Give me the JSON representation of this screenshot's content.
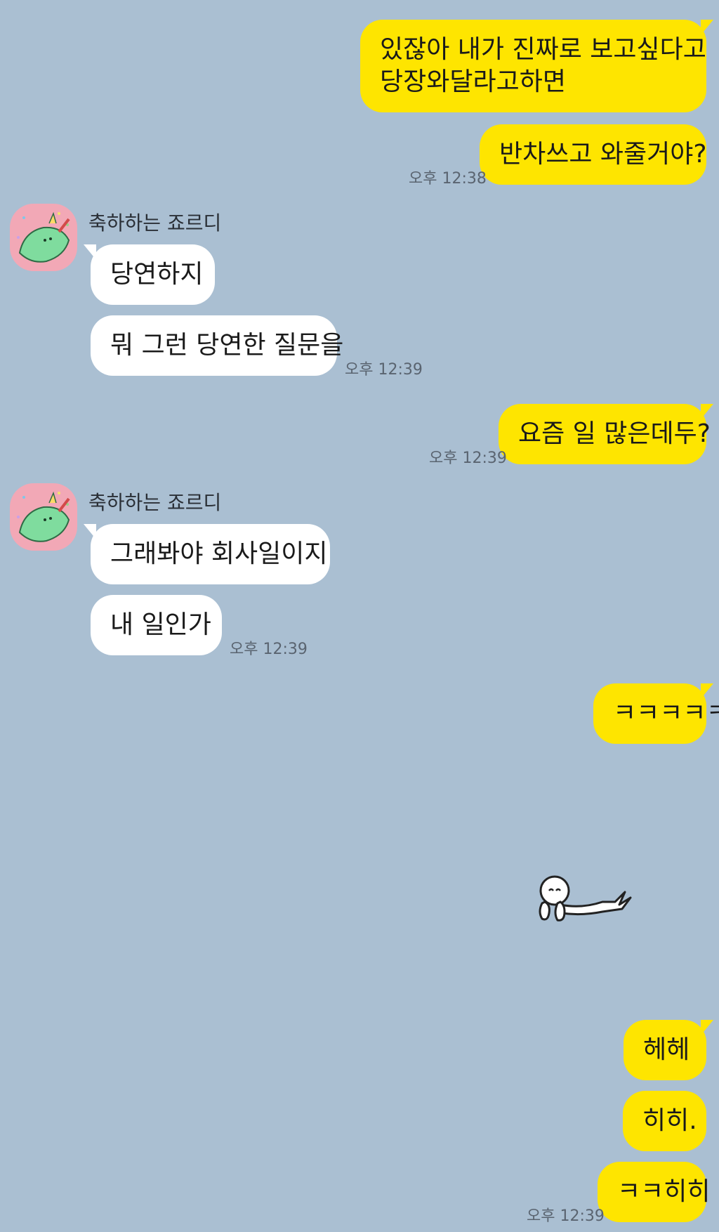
{
  "contact": {
    "name": "축하하는 죠르디"
  },
  "messages": {
    "m1": "있잖아 내가 진짜로 보고싶다고\n당장와달라고하면",
    "m2": "반차쓰고 와줄거야?",
    "t1": "오후 12:38",
    "m3": "당연하지",
    "m4": "뭐 그런 당연한 질문을",
    "t2": "오후 12:39",
    "m5": "요즘 일 많은데두?",
    "t3": "오후 12:39",
    "m6": "그래봐야 회사일이지",
    "m7": "내 일인가",
    "t4": "오후 12:39",
    "m8": "ㅋㅋㅋㅋㅋ",
    "m9": "헤헤",
    "m10": "히히.",
    "m11": "ㅋㅋ히히",
    "t5": "오후 12:39"
  },
  "colors": {
    "background": "#aabfd2",
    "my_bubble": "#fee500",
    "their_bubble": "#ffffff",
    "avatar_bg": "#f2a8b6"
  },
  "icons": {
    "avatar": "jordy-dinosaur-avatar-icon",
    "sticker": "lying-character-sticker-icon"
  }
}
